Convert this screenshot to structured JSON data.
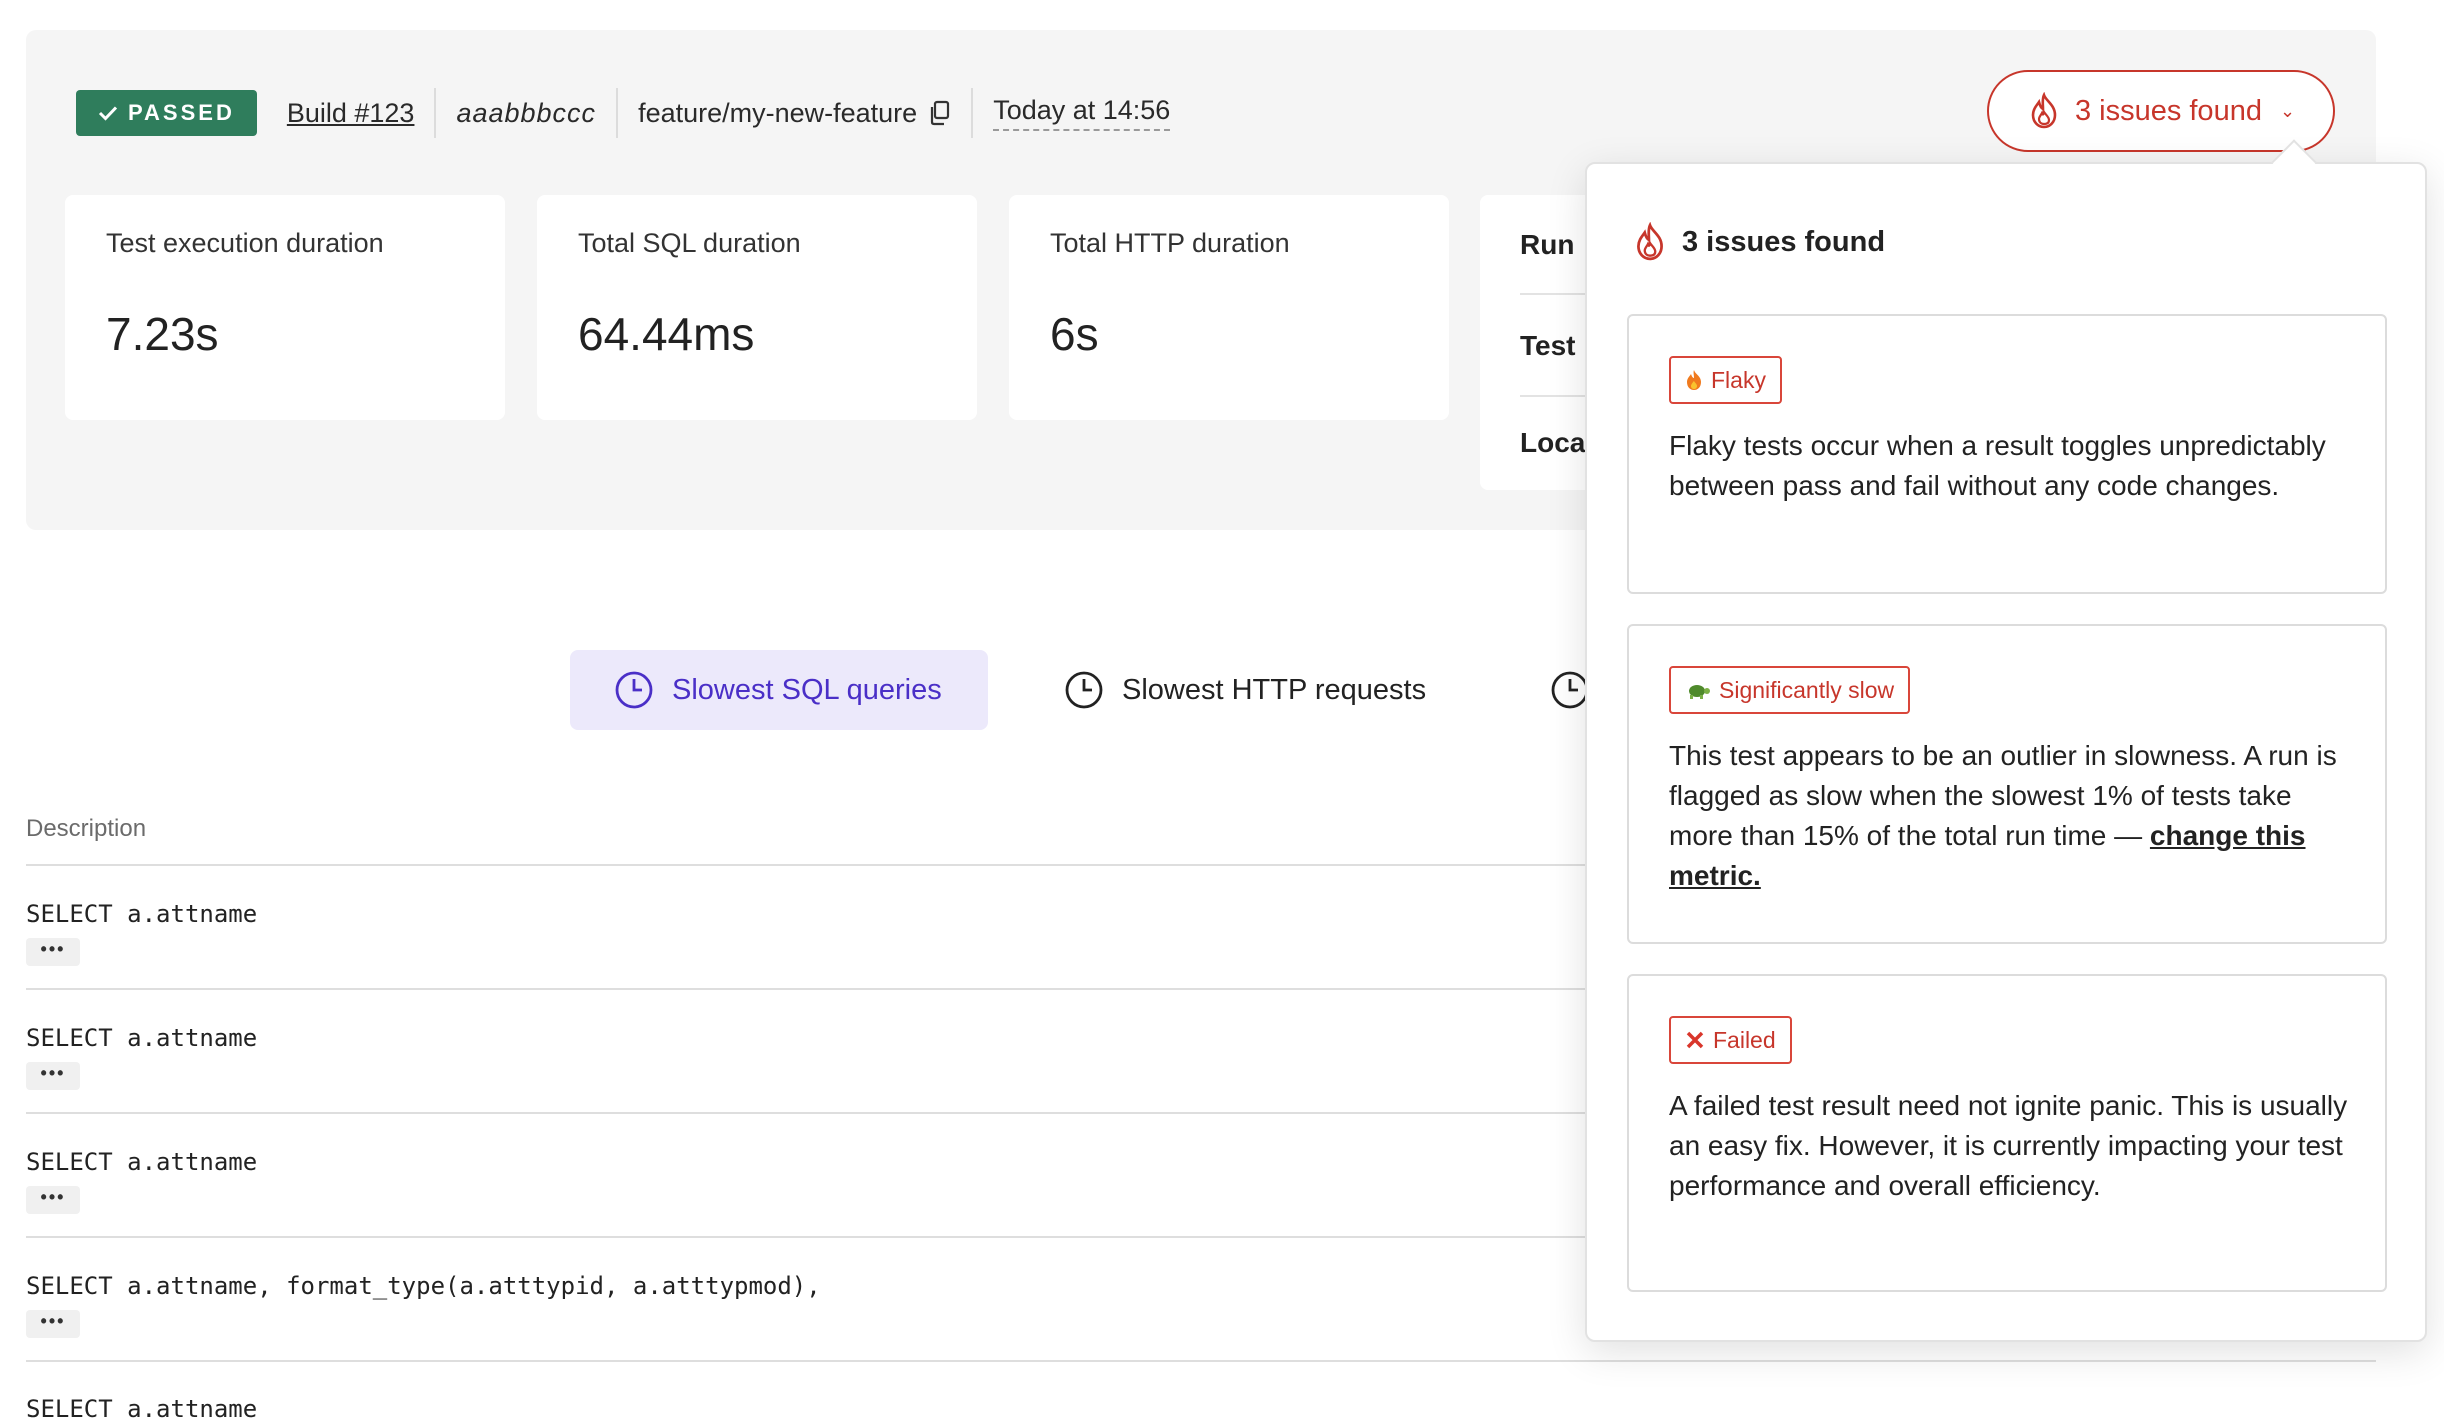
{
  "header": {
    "status": "PASSED",
    "build_link": "Build #123",
    "commit_sha": "aaabbbccc",
    "branch": "feature/my-new-feature",
    "timestamp": "Today at 14:56",
    "issues_button": "3 issues found"
  },
  "stats": [
    {
      "label": "Test execution duration",
      "value": "7.23s"
    },
    {
      "label": "Total SQL duration",
      "value": "64.44ms"
    },
    {
      "label": "Total HTTP duration",
      "value": "6s"
    }
  ],
  "info_rows": [
    "Run",
    "Test",
    "Loca"
  ],
  "tabs": [
    {
      "label": "Slowest SQL queries"
    },
    {
      "label": "Slowest HTTP requests"
    }
  ],
  "table": {
    "column_description": "Description",
    "rows": [
      "SELECT a.attname",
      "SELECT a.attname",
      "SELECT a.attname",
      "SELECT a.attname, format_type(a.atttypid, a.atttypmod),",
      "SELECT a.attname"
    ],
    "more_label": "•••"
  },
  "popover": {
    "title": "3 issues found",
    "issues": [
      {
        "tag": "Flaky",
        "text": "Flaky tests occur when a result toggles unpredictably between pass and fail without any code changes."
      },
      {
        "tag": "Significantly slow",
        "text": "This test appears to be an outlier in slowness. A run is flagged as slow when the slowest 1% of tests take more than 15% of the total run time — ",
        "link": "change this metric."
      },
      {
        "tag": "Failed",
        "text": "A failed test result need not ignite panic. This is usually an easy fix. However, it is currently impacting your test performance and overall efficiency."
      }
    ]
  },
  "colors": {
    "passed_green": "#2f7d5c",
    "issue_red": "#c7362b",
    "active_tab_bg": "#ece9fb",
    "active_tab_text": "#4a2fc7"
  }
}
